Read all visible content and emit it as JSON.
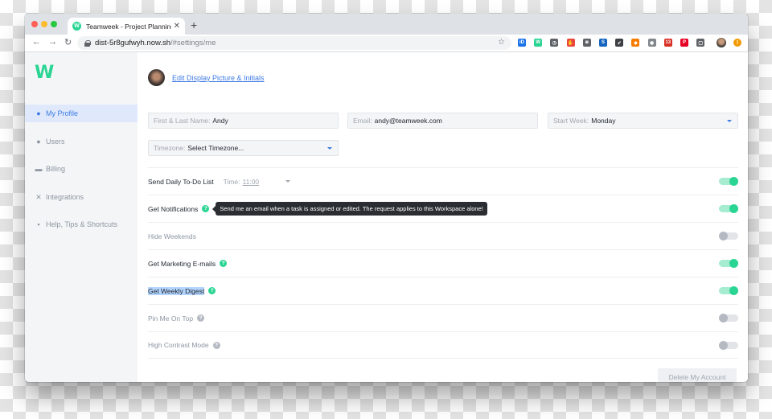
{
  "browser": {
    "tab_title": "Teamweek - Project Planning C",
    "tab_favicon_letter": "W",
    "tab_close": "✕",
    "new_tab": "+",
    "back": "←",
    "forward": "→",
    "reload": "↻",
    "url_host": "dist-5r8gufwyh.now.sh",
    "url_path": "/#settings/me",
    "bookmark_icon": "star-icon",
    "extensions": [
      {
        "name": "ext-id-icon",
        "label": "iD",
        "color": "#1a73e8"
      },
      {
        "name": "ext-teamweek-icon",
        "label": "W",
        "color": "#2ad593"
      },
      {
        "name": "ext-gauge-icon",
        "label": "◷",
        "color": "#5f6368"
      },
      {
        "name": "ext-adblock-icon",
        "label": "✋",
        "color": "#e8453c"
      },
      {
        "name": "ext-camera-icon",
        "label": "◙",
        "color": "#5f6368"
      },
      {
        "name": "ext-s-icon",
        "label": "S",
        "color": "#1565c0"
      },
      {
        "name": "ext-rocket-icon",
        "label": "➶",
        "color": "#3c4043"
      },
      {
        "name": "ext-box-icon",
        "label": "◆",
        "color": "#f57c00"
      },
      {
        "name": "ext-puzzle-icon",
        "label": "◉",
        "color": "#80868b"
      },
      {
        "name": "ext-mail-icon",
        "label": "13",
        "color": "#d93025"
      },
      {
        "name": "ext-pinterest-icon",
        "label": "P",
        "color": "#e60023"
      },
      {
        "name": "ext-screenshot-icon",
        "label": "▢",
        "color": "#5f6368"
      }
    ],
    "menu_badge": "!"
  },
  "app": {
    "logo": "W",
    "accent": "#2ad593",
    "link_color": "#3f7be4"
  },
  "sidebar": {
    "items": [
      {
        "label": "My Profile",
        "icon": "user-icon",
        "glyph": "👤",
        "active": true
      },
      {
        "label": "Users",
        "icon": "users-icon",
        "glyph": "👥",
        "active": false
      },
      {
        "label": "Billing",
        "icon": "billing-icon",
        "glyph": "▬",
        "active": false
      },
      {
        "label": "Integrations",
        "icon": "integrations-icon",
        "glyph": "✕",
        "active": false
      },
      {
        "label": "Help, Tips & Shortcuts",
        "icon": "help-chat-icon",
        "glyph": "▪",
        "active": false
      }
    ]
  },
  "profile": {
    "edit_link": "Edit Display Picture & Initials",
    "name_label": "First & Last Name:",
    "name_value": "Andy",
    "email_label": "Email:",
    "email_value": "andy@teamweek.com",
    "start_week_label": "Start Week:",
    "start_week_value": "Monday",
    "timezone_label": "Timezone:",
    "timezone_value": "Select Timezone..."
  },
  "settings": {
    "daily_todo": {
      "label": "Send Daily To-Do List",
      "time_label": "Time:",
      "time_value": "11:00",
      "on": true
    },
    "notifications": {
      "label": "Get Notifications",
      "tooltip": "Send me an email when a task is assigned or edited. The request applies to this Workspace alone!",
      "on": true
    },
    "hide_weekends": {
      "label": "Hide Weekends",
      "on": false
    },
    "marketing": {
      "label": "Get Marketing E-mails",
      "on": true
    },
    "weekly_digest": {
      "label": "Get Weekly Digest",
      "on": true
    },
    "pin_me": {
      "label": "Pin Me On Top",
      "on": false
    },
    "high_contrast": {
      "label": "High Contrast Mode",
      "on": false
    },
    "help_glyph": "?"
  },
  "delete_button": "Delete My Account"
}
